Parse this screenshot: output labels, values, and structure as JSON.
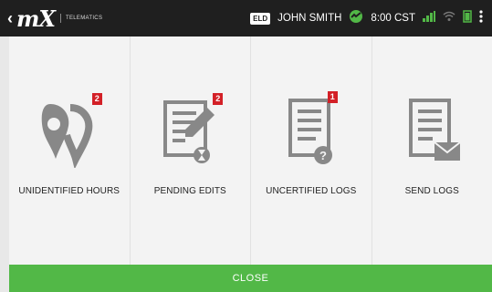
{
  "header": {
    "back_glyph": "‹",
    "logo_text": "mX",
    "logo_sub": "TELEMATICS",
    "eld_badge": "ELD",
    "driver_name": "JOHN SMITH",
    "time": "8:00 CST",
    "status_color": "#52b847"
  },
  "tiles": [
    {
      "label": "UNIDENTIFIED HOURS",
      "icon": "location-pin-icon",
      "badge": "2"
    },
    {
      "label": "PENDING EDITS",
      "icon": "edit-document-icon",
      "badge": "2"
    },
    {
      "label": "UNCERTIFIED LOGS",
      "icon": "question-document-icon",
      "badge": "1"
    },
    {
      "label": "SEND LOGS",
      "icon": "mail-document-icon",
      "badge": ""
    }
  ],
  "footer": {
    "close_label": "CLOSE",
    "color": "#52b847"
  }
}
